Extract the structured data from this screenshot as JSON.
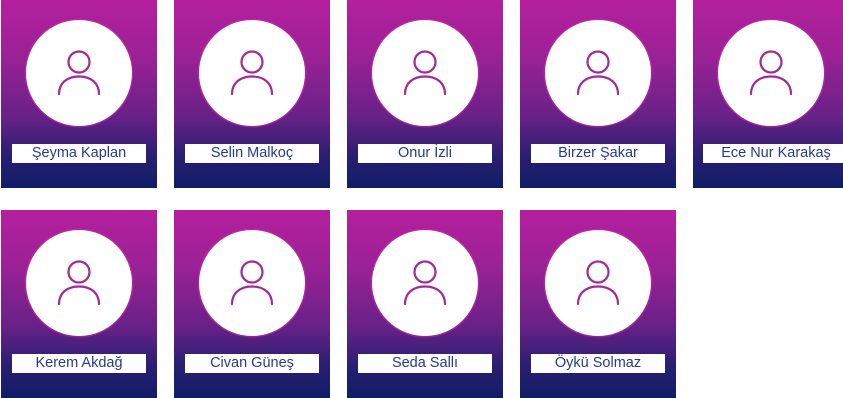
{
  "colors": {
    "gradient_top": "#b51f9e",
    "gradient_bottom": "#101d66",
    "icon_stroke": "#a12a99",
    "name_text": "#263a8f"
  },
  "team": {
    "members": [
      {
        "name": "Şeyma Kaplan",
        "icon": "user-icon"
      },
      {
        "name": "Selin Malkoç",
        "icon": "user-icon"
      },
      {
        "name": "Onur İzli",
        "icon": "user-icon"
      },
      {
        "name": "Birzer Şakar",
        "icon": "user-icon"
      },
      {
        "name": "Ece Nur Karakaş",
        "icon": "user-icon"
      },
      {
        "name": "Kerem Akdağ",
        "icon": "user-icon"
      },
      {
        "name": "Civan Güneş",
        "icon": "user-icon"
      },
      {
        "name": "Seda Sallı",
        "icon": "user-icon"
      },
      {
        "name": "Öykü Solmaz",
        "icon": "user-icon"
      }
    ]
  }
}
